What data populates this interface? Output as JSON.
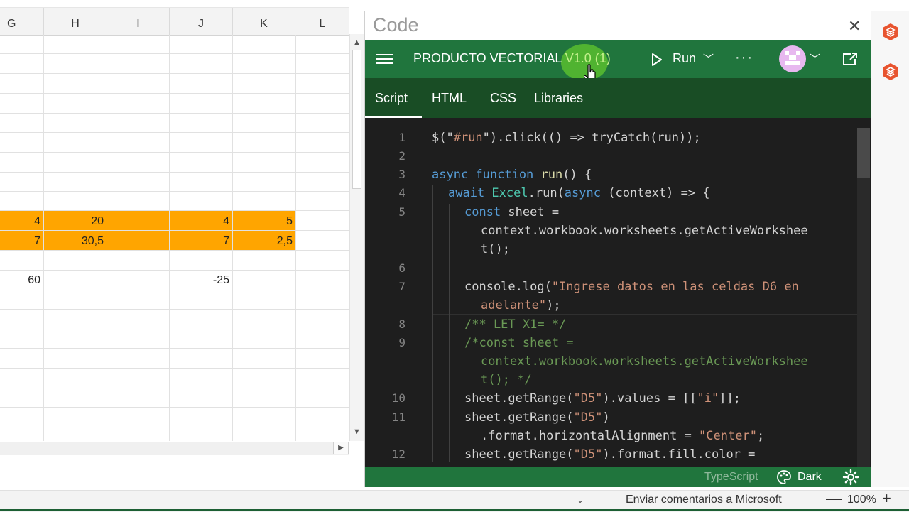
{
  "spreadsheet": {
    "columns": [
      "G",
      "H",
      "I",
      "J",
      "K",
      "L"
    ],
    "cells": {
      "g_row1": "4",
      "h_row1": "20",
      "j_row1": "4",
      "k_row1": "5",
      "g_row2": "7",
      "h_row2": "30,5",
      "j_row2": "7",
      "k_row2": "2,5",
      "g_row3": "60",
      "j_row3": "-25"
    },
    "highlight_color": "#ffa500"
  },
  "code_pane": {
    "title": "Code",
    "close_icon": "close-icon",
    "snippet_name": "PRODUCTO VECTORIAL ",
    "snippet_version": "V1.0 (1)",
    "run_label": "Run",
    "more_label": "···",
    "tabs": [
      "Script",
      "HTML",
      "CSS",
      "Libraries"
    ],
    "active_tab": "Script",
    "language": "TypeScript",
    "theme_label": "Dark",
    "accent_color": "#20753d",
    "tab_bar_color": "#194d25"
  },
  "code": {
    "line_numbers": [
      "1",
      "2",
      "3",
      "4",
      "5",
      "6",
      "7",
      "8",
      "9",
      "10",
      "11",
      "12"
    ]
  },
  "bottom_bar": {
    "feedback": "Enviar comentarios a Microsoft",
    "zoom": "100%",
    "zoom_minus": "—",
    "zoom_plus": "+"
  }
}
